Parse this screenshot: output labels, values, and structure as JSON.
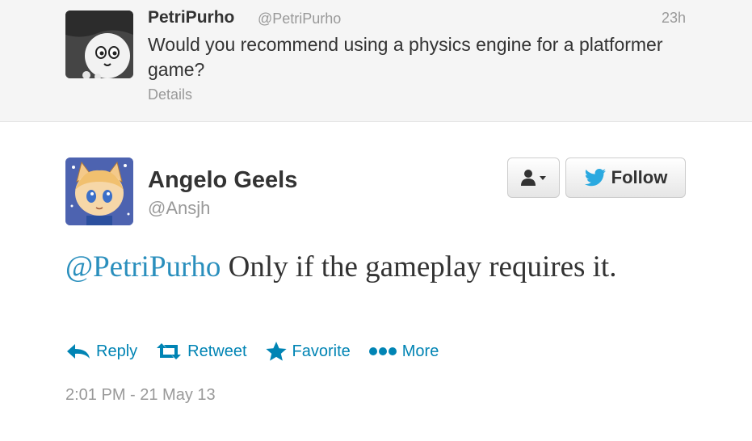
{
  "context_tweet": {
    "name": "PetriPurho",
    "handle": "@PetriPurho",
    "time": "23h",
    "text": "Would you recommend using a physics engine for a platformer game?",
    "details_label": "Details"
  },
  "tweet": {
    "name": "Angelo Geels",
    "handle": "@Ansjh",
    "mention": "@PetriPurho",
    "text": " Only if the gameplay requires it.",
    "timestamp": "2:01 PM - 21 May 13"
  },
  "buttons": {
    "follow_label": "Follow"
  },
  "actions": [
    {
      "label": "Reply",
      "icon": "reply-icon"
    },
    {
      "label": "Retweet",
      "icon": "retweet-icon"
    },
    {
      "label": "Favorite",
      "icon": "star-icon"
    },
    {
      "label": "More",
      "icon": "more-dots-icon"
    }
  ],
  "colors": {
    "link": "#0084b4",
    "mention": "#2a8fbd",
    "twitter_bird": "#2aa9e0",
    "muted": "#999999",
    "text": "#333333"
  }
}
